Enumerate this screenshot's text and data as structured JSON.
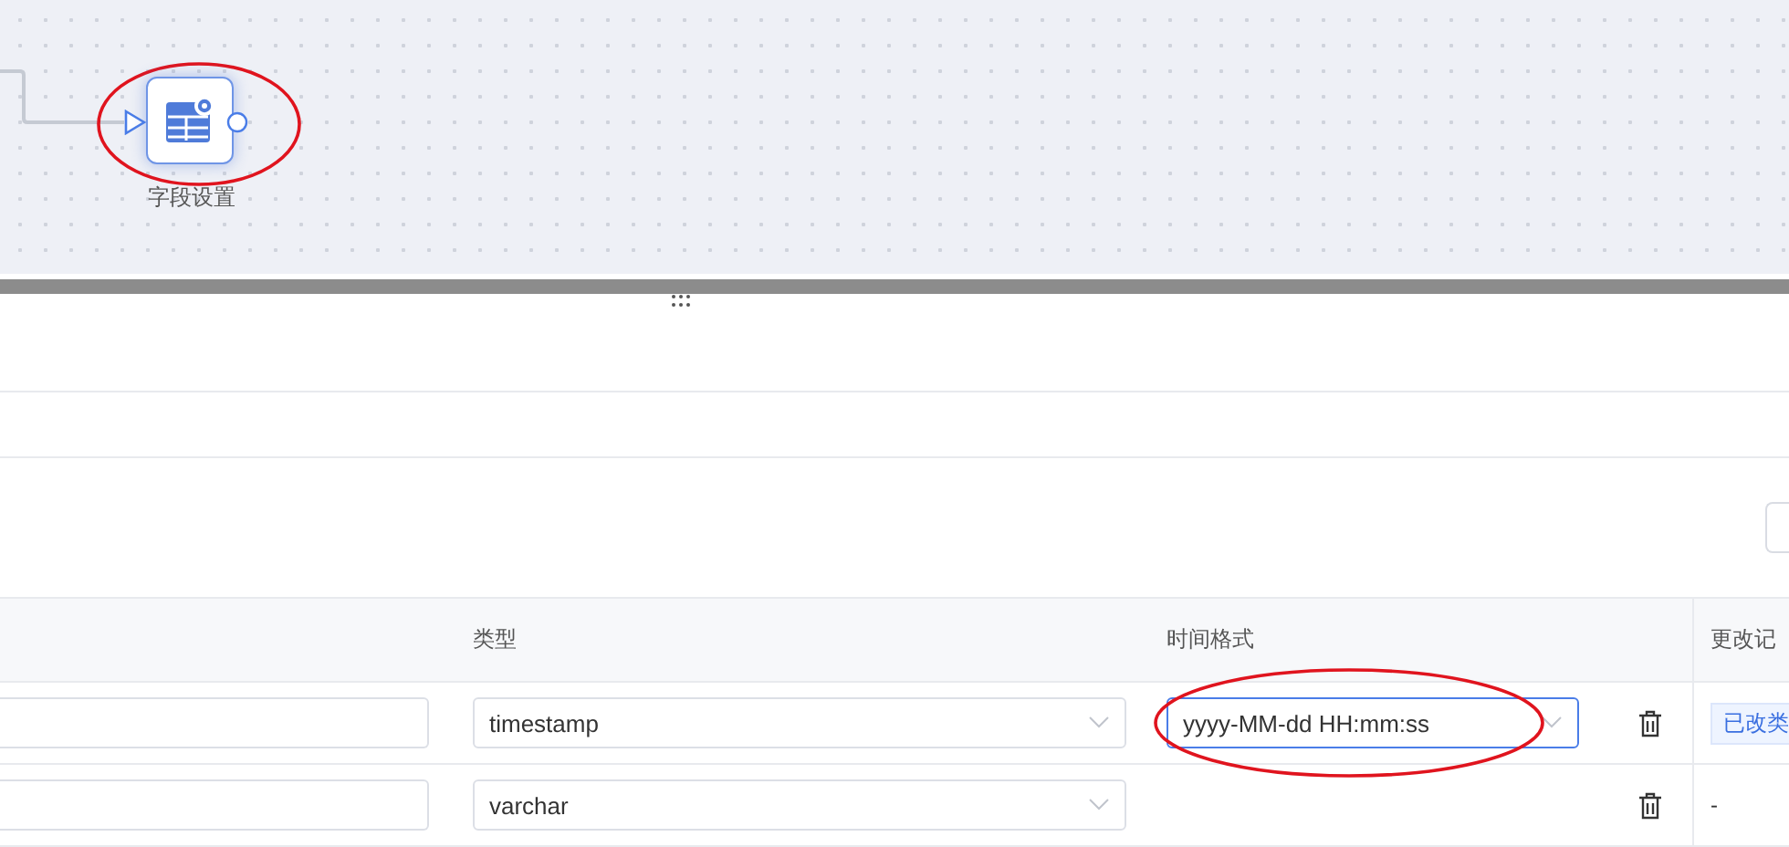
{
  "canvas": {
    "node": {
      "label": "字段设置",
      "selected": true
    }
  },
  "table": {
    "columns": [
      "类型",
      "时间格式",
      "更改记"
    ],
    "rows": [
      {
        "type": "timestamp",
        "time_format": "yyyy-MM-dd HH:mm:ss",
        "time_format_focused": true,
        "change": {
          "kind": "tag",
          "text": "已改类"
        }
      },
      {
        "type": "varchar",
        "change": {
          "kind": "text",
          "text": "-"
        }
      }
    ]
  }
}
